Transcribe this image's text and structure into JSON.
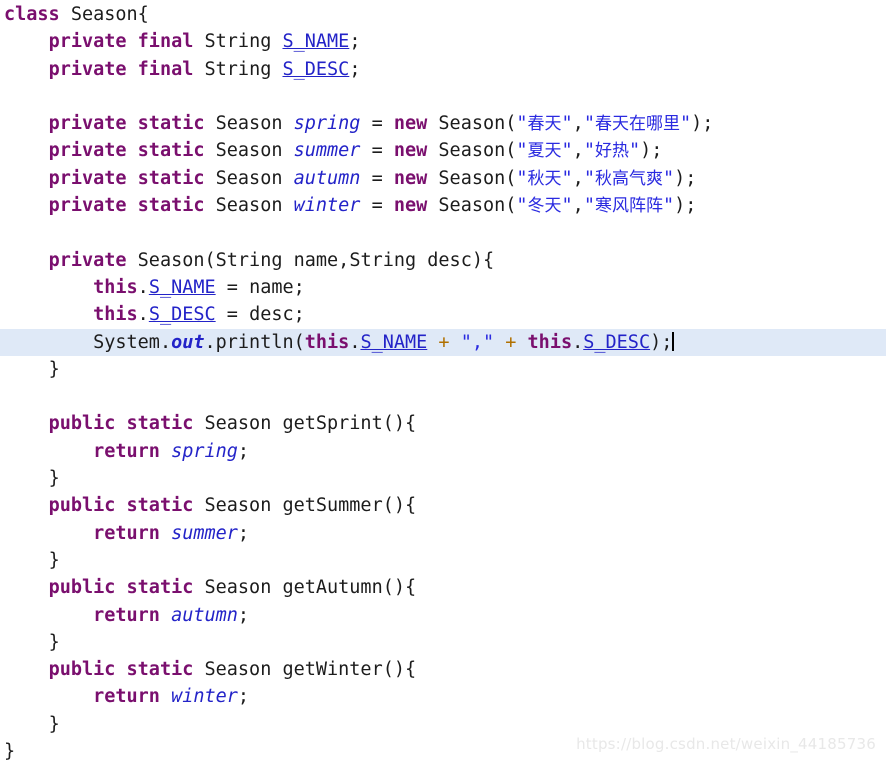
{
  "editor": {
    "language": "java",
    "background_color": "#ffffff",
    "current_line_highlight_color": "#dfe9f7",
    "caret_visible": true,
    "colors": {
      "keyword": "#7a0f6e",
      "instance_field": "#2323c8",
      "static_field": "#2323c8",
      "string": "#2a2ae0",
      "operator": "#b07000",
      "plain_text": "#1c1c1c"
    }
  },
  "code": {
    "class_name": "Season",
    "lines": [
      {
        "n": 1,
        "text": "class Season{"
      },
      {
        "n": 2,
        "text": "    private final String S_NAME;"
      },
      {
        "n": 3,
        "text": "    private final String S_DESC;"
      },
      {
        "n": 4,
        "text": ""
      },
      {
        "n": 5,
        "text": "    private static Season spring = new Season(\"春天\",\"春天在哪里\");"
      },
      {
        "n": 6,
        "text": "    private static Season summer = new Season(\"夏天\",\"好热\");"
      },
      {
        "n": 7,
        "text": "    private static Season autumn = new Season(\"秋天\",\"秋高气爽\");"
      },
      {
        "n": 8,
        "text": "    private static Season winter = new Season(\"冬天\",\"寒风阵阵\");"
      },
      {
        "n": 9,
        "text": ""
      },
      {
        "n": 10,
        "text": "    private Season(String name,String desc){"
      },
      {
        "n": 11,
        "text": "        this.S_NAME = name;"
      },
      {
        "n": 12,
        "text": "        this.S_DESC = desc;"
      },
      {
        "n": 13,
        "text": "        System.out.println(this.S_NAME + \",\" + this.S_DESC);",
        "highlighted": true
      },
      {
        "n": 14,
        "text": "    }"
      },
      {
        "n": 15,
        "text": ""
      },
      {
        "n": 16,
        "text": "    public static Season getSprint(){"
      },
      {
        "n": 17,
        "text": "        return spring;"
      },
      {
        "n": 18,
        "text": "    }"
      },
      {
        "n": 19,
        "text": "    public static Season getSummer(){"
      },
      {
        "n": 20,
        "text": "        return summer;"
      },
      {
        "n": 21,
        "text": "    }"
      },
      {
        "n": 22,
        "text": "    public static Season getAutumn(){"
      },
      {
        "n": 23,
        "text": "        return autumn;"
      },
      {
        "n": 24,
        "text": "    }"
      },
      {
        "n": 25,
        "text": "    public static Season getWinter(){"
      },
      {
        "n": 26,
        "text": "        return winter;"
      },
      {
        "n": 27,
        "text": "    }"
      },
      {
        "n": 28,
        "text": "}"
      }
    ],
    "tokens": {
      "kw_class": "class",
      "kw_private": "private",
      "kw_public": "public",
      "kw_final": "final",
      "kw_static": "static",
      "kw_new": "new",
      "kw_this": "this",
      "kw_return": "return",
      "type_string": "String",
      "type_season": "Season",
      "field_sname": "S_NAME",
      "field_sdesc": "S_DESC",
      "static_spring": "spring",
      "static_summer": "summer",
      "static_autumn": "autumn",
      "static_winter": "winter",
      "static_out": "out",
      "ident_system": "System",
      "ident_println": "println",
      "ident_name": "name",
      "ident_desc": "desc",
      "method_get_sprint": "getSprint",
      "method_get_summer": "getSummer",
      "method_get_autumn": "getAutumn",
      "method_get_winter": "getWinter",
      "op_plus": "+",
      "op_assign": "="
    },
    "strings": {
      "spring_name": "春天",
      "spring_desc": "春天在哪里",
      "summer_name": "夏天",
      "summer_desc": "好热",
      "autumn_name": "秋天",
      "autumn_desc": "秋高气爽",
      "winter_name": "冬天",
      "winter_desc": "寒风阵阵",
      "separator": ","
    }
  },
  "watermark": {
    "text": "https://blog.csdn.net/weixin_44185736"
  }
}
